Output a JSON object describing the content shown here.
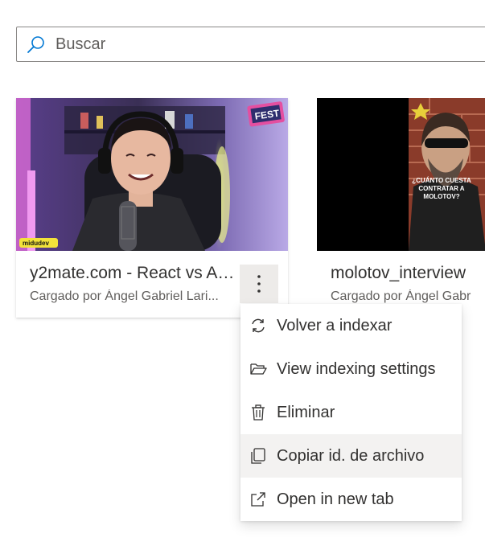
{
  "search": {
    "placeholder": "Buscar",
    "icon": "search-icon"
  },
  "cards": [
    {
      "title": "y2mate.com - React vs An...",
      "subtitle": "Cargado por Ángel Gabriel Lari...",
      "thumbnail_badge": "midudev",
      "thumbnail_logo": "FEST",
      "more_icon": "more-vertical-icon"
    },
    {
      "title": "molotov_interview",
      "subtitle": "Cargado por Ángel Gabr",
      "thumbnail_caption": "¿CUÁNTO CUESTA CONTRATAR A MOLOTOV?"
    }
  ],
  "context_menu": {
    "items": [
      {
        "label": "Volver a indexar",
        "icon": "refresh-icon"
      },
      {
        "label": "View indexing settings",
        "icon": "folder-open-icon"
      },
      {
        "label": "Eliminar",
        "icon": "trash-icon"
      },
      {
        "label": "Copiar id. de archivo",
        "icon": "copy-icon",
        "hovered": true
      },
      {
        "label": "Open in new tab",
        "icon": "open-external-icon"
      }
    ]
  },
  "colors": {
    "accent": "#0078d4",
    "text": "#323130",
    "subtext": "#605e5c",
    "menu_hover": "#f3f2f1",
    "button_bg": "#edebe9"
  }
}
